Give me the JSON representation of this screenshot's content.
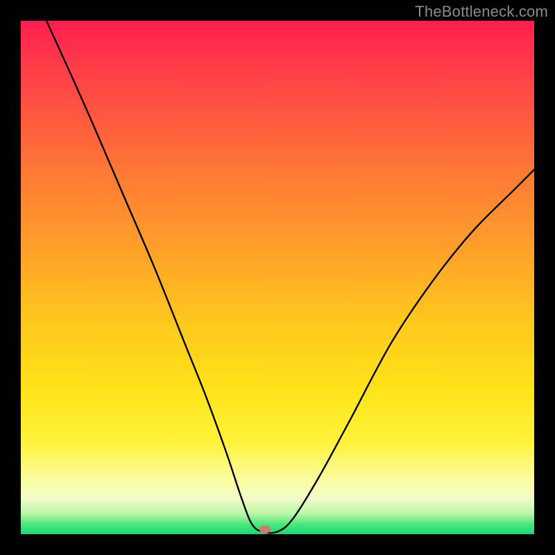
{
  "watermark": "TheBottleneck.com",
  "marker": {
    "x_pct": 47.5,
    "y_pct": 99.0
  },
  "chart_data": {
    "type": "line",
    "title": "",
    "xlabel": "",
    "ylabel": "",
    "xlim": [
      0,
      100
    ],
    "ylim": [
      0,
      100
    ],
    "series": [
      {
        "name": "bottleneck-curve",
        "x": [
          5,
          10,
          14,
          20,
          26,
          32,
          36,
          40,
          43,
          45,
          47,
          50,
          53,
          58,
          64,
          72,
          80,
          88,
          96,
          100
        ],
        "y": [
          100,
          89,
          80,
          66,
          52,
          37,
          27,
          16,
          7,
          2,
          0.5,
          0.5,
          3,
          11,
          22,
          37,
          49,
          59,
          67,
          71
        ]
      }
    ],
    "annotations": [
      {
        "name": "optimal-marker",
        "x": 47.5,
        "y": 0.8
      }
    ],
    "background_gradient": {
      "stops": [
        {
          "pct": 0,
          "color": "#ff1d4f"
        },
        {
          "pct": 45,
          "color": "#ffa229"
        },
        {
          "pct": 82,
          "color": "#fff23a"
        },
        {
          "pct": 100,
          "color": "#17d775"
        }
      ]
    }
  }
}
